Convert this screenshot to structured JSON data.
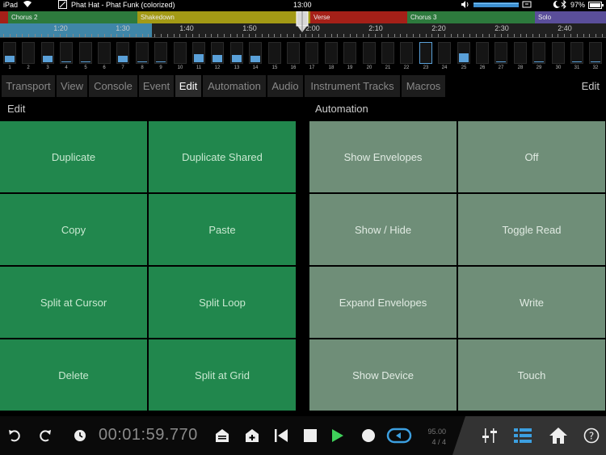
{
  "status": {
    "device": "iPad",
    "title": "Phat Hat - Phat Funk (colorized)",
    "time": "13:00",
    "battery": "97%"
  },
  "markers": [
    {
      "label": "Chorus 2",
      "color": "#2d7a3d"
    },
    {
      "label": "Shakedown",
      "color": "#a39a15"
    },
    {
      "label": "Verse",
      "color": "#a52018"
    },
    {
      "label": "Chorus 3",
      "color": "#2d7a3d"
    },
    {
      "label": "Solo",
      "color": "#5a4e9a"
    }
  ],
  "timeline": [
    "1:20",
    "1:30",
    "1:40",
    "1:50",
    "2:00",
    "2:10",
    "2:20",
    "2:30",
    "2:40"
  ],
  "pads": [
    {
      "n": "1",
      "level": 0.3,
      "outlined": false
    },
    {
      "n": "2",
      "level": 0,
      "outlined": false
    },
    {
      "n": "3",
      "level": 0.3,
      "outlined": false
    },
    {
      "n": "4",
      "level": 0.05,
      "outlined": false
    },
    {
      "n": "5",
      "level": 0.05,
      "outlined": false
    },
    {
      "n": "6",
      "level": 0,
      "outlined": false
    },
    {
      "n": "7",
      "level": 0.3,
      "outlined": false
    },
    {
      "n": "8",
      "level": 0.05,
      "outlined": false
    },
    {
      "n": "9",
      "level": 0.05,
      "outlined": false
    },
    {
      "n": "10",
      "level": 0,
      "outlined": false
    },
    {
      "n": "11",
      "level": 0.4,
      "outlined": false
    },
    {
      "n": "12",
      "level": 0.35,
      "outlined": false
    },
    {
      "n": "13",
      "level": 0.35,
      "outlined": false
    },
    {
      "n": "14",
      "level": 0.3,
      "outlined": false
    },
    {
      "n": "15",
      "level": 0,
      "outlined": false
    },
    {
      "n": "16",
      "level": 0,
      "outlined": false
    },
    {
      "n": "17",
      "level": 0,
      "outlined": false
    },
    {
      "n": "18",
      "level": 0,
      "outlined": false
    },
    {
      "n": "19",
      "level": 0,
      "outlined": false
    },
    {
      "n": "20",
      "level": 0,
      "outlined": false
    },
    {
      "n": "21",
      "level": 0,
      "outlined": false
    },
    {
      "n": "22",
      "level": 0,
      "outlined": false
    },
    {
      "n": "23",
      "level": 0,
      "outlined": true
    },
    {
      "n": "24",
      "level": 0,
      "outlined": false
    },
    {
      "n": "25",
      "level": 0.45,
      "outlined": false
    },
    {
      "n": "26",
      "level": 0,
      "outlined": false
    },
    {
      "n": "27",
      "level": 0.05,
      "outlined": false
    },
    {
      "n": "28",
      "level": 0,
      "outlined": false
    },
    {
      "n": "29",
      "level": 0.05,
      "outlined": false
    },
    {
      "n": "30",
      "level": 0,
      "outlined": false
    },
    {
      "n": "31",
      "level": 0.05,
      "outlined": false
    },
    {
      "n": "32",
      "level": 0.05,
      "outlined": false
    }
  ],
  "tabs": [
    "Transport",
    "View",
    "Console",
    "Event",
    "Edit",
    "Automation",
    "Audio",
    "Instrument Tracks",
    "Macros"
  ],
  "active_tab": "Edit",
  "tab_right_label": "Edit",
  "edit_panel": {
    "title": "Edit",
    "buttons": [
      "Duplicate",
      "Duplicate Shared",
      "Copy",
      "Paste",
      "Split at Cursor",
      "Split Loop",
      "Delete",
      "Split at Grid"
    ]
  },
  "automation_panel": {
    "title": "Automation",
    "buttons": [
      "Show Envelopes",
      "Off",
      "Show / Hide",
      "Toggle Read",
      "Expand Envelopes",
      "Write",
      "Show Device",
      "Touch"
    ]
  },
  "transport": {
    "position": "00:01:59.770",
    "tempo": "95.00",
    "signature": "4 / 4"
  },
  "colors": {
    "edit_button": "#21874d",
    "automation_button": "#6f8e78",
    "accent_blue": "#5aa0d8",
    "play_green": "#3fd15a"
  }
}
